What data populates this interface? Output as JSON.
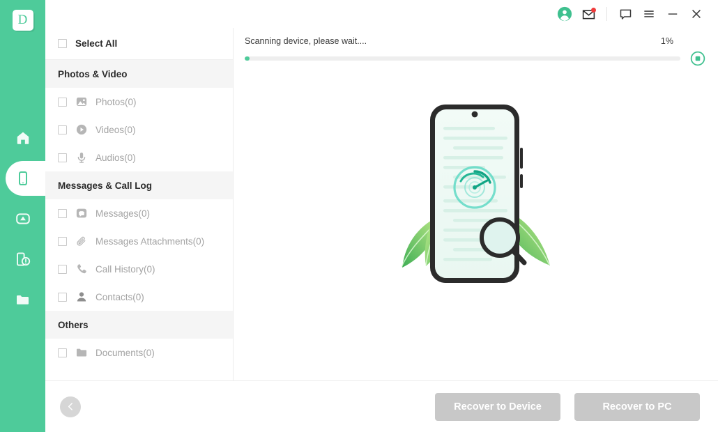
{
  "brand": {
    "logo_letter": "D",
    "accent": "#4ecb9a",
    "rail_bg": "#4ecb9a"
  },
  "rail": {
    "items": [
      {
        "name": "home-icon",
        "label": "Home"
      },
      {
        "name": "phone-icon",
        "label": "Device Recovery",
        "active": true
      },
      {
        "name": "cloud-icon",
        "label": "Cloud Recovery"
      },
      {
        "name": "device-repair-icon",
        "label": "Device Repair"
      },
      {
        "name": "folder-icon",
        "label": "Recovered Files"
      }
    ]
  },
  "header": {
    "buttons": [
      {
        "name": "account-avatar",
        "label": "Account"
      },
      {
        "name": "mail-icon",
        "label": "Messages",
        "badge": true
      },
      {
        "name": "feedback-icon",
        "label": "Feedback"
      },
      {
        "name": "menu-icon",
        "label": "Menu"
      },
      {
        "name": "minimize-icon",
        "label": "Minimize"
      },
      {
        "name": "close-icon",
        "label": "Close"
      }
    ]
  },
  "panel": {
    "select_all_label": "Select All",
    "groups": [
      {
        "title": "Photos & Video",
        "items": [
          {
            "label": "Photos(0)",
            "icon": "photo-icon"
          },
          {
            "label": "Videos(0)",
            "icon": "video-icon"
          },
          {
            "label": "Audios(0)",
            "icon": "audio-icon"
          }
        ]
      },
      {
        "title": "Messages & Call Log",
        "items": [
          {
            "label": "Messages(0)",
            "icon": "message-icon"
          },
          {
            "label": "Messages Attachments(0)",
            "icon": "attachment-icon"
          },
          {
            "label": "Call History(0)",
            "icon": "call-icon"
          },
          {
            "label": "Contacts(0)",
            "icon": "contact-icon"
          }
        ]
      },
      {
        "title": "Others",
        "items": [
          {
            "label": "Documents(0)",
            "icon": "document-icon"
          }
        ]
      }
    ]
  },
  "scan": {
    "status_text": "Scanning device, please wait....",
    "percent_label": "1%",
    "percent_value": 1,
    "stop_button_label": "Stop"
  },
  "footer": {
    "back_label": "Back",
    "recover_to_device_label": "Recover to Device",
    "recover_to_pc_label": "Recover to PC"
  }
}
